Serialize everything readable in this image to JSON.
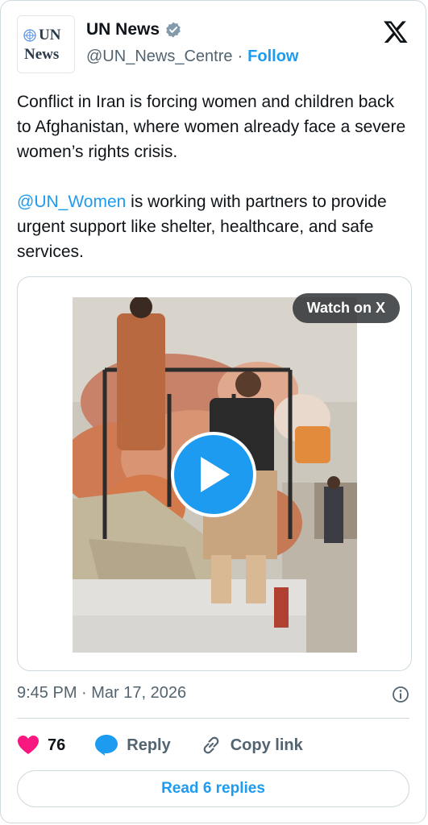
{
  "author": {
    "avatar_text_line1": "UN",
    "avatar_text_line2": "News",
    "display_name": "UN News",
    "handle": "@UN_News_Centre",
    "separator": "·",
    "follow_label": "Follow"
  },
  "tweet": {
    "paragraph1": "Conflict in Iran is forcing women and children back to Afghanistan, where women already face a severe women’s rights crisis.",
    "mention": "@UN_Women",
    "paragraph2_rest": " is working with partners to provide urgent support like shelter, healthcare, and safe services."
  },
  "media": {
    "watch_label": "Watch on X"
  },
  "meta": {
    "timestamp": "9:45 PM · Mar 17, 2026"
  },
  "actions": {
    "like_count": "76",
    "reply_label": "Reply",
    "copy_link_label": "Copy link"
  },
  "footer": {
    "read_replies_label": "Read 6 replies"
  },
  "colors": {
    "accent": "#1d9bf0",
    "like": "#f91880",
    "muted": "#536471"
  }
}
